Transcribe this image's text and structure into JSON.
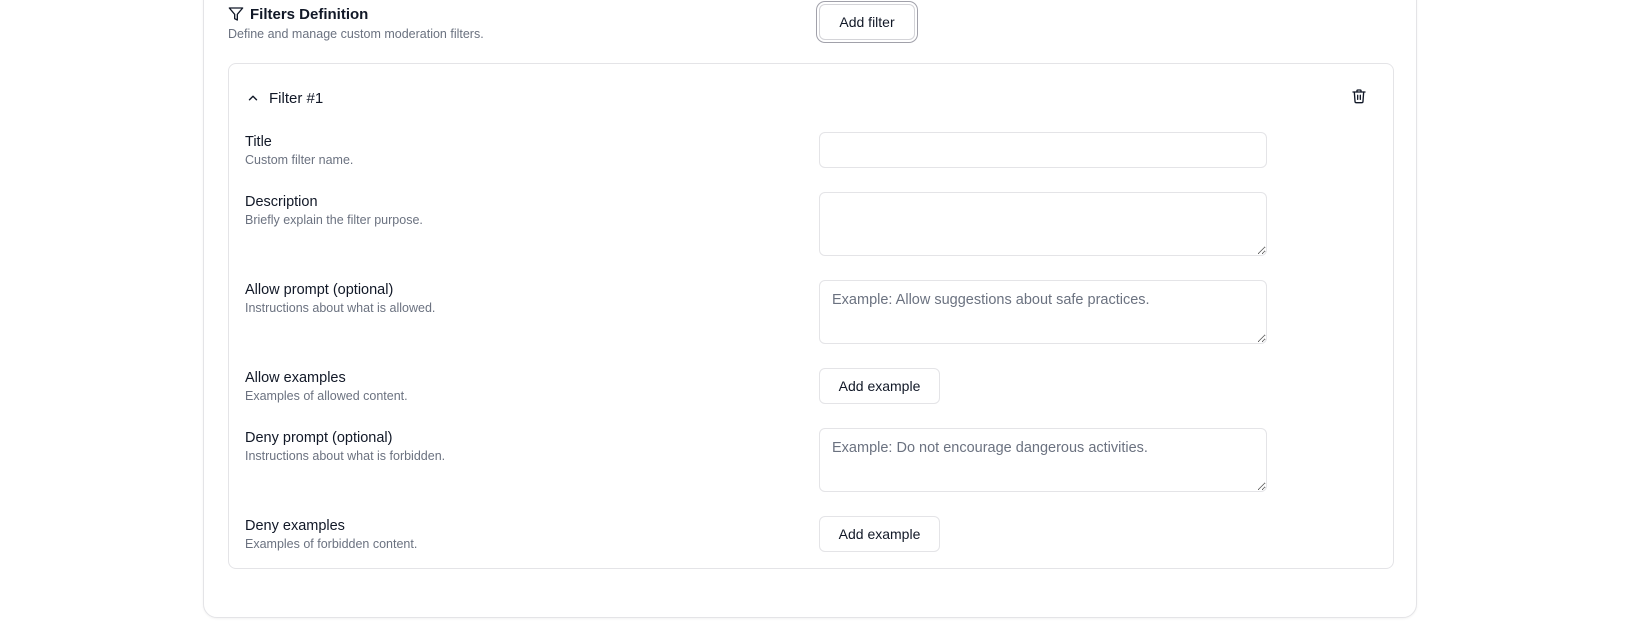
{
  "section": {
    "title": "Filters Definition",
    "description": "Define and manage custom moderation filters.",
    "add_filter_label": "Add filter",
    "icon": "filter-icon"
  },
  "filter": {
    "name": "Filter #1",
    "expanded": true,
    "fields": {
      "title": {
        "label": "Title",
        "help": "Custom filter name.",
        "value": "",
        "placeholder": ""
      },
      "description": {
        "label": "Description",
        "help": "Briefly explain the filter purpose.",
        "value": "",
        "placeholder": ""
      },
      "allow_prompt": {
        "label": "Allow prompt (optional)",
        "help": "Instructions about what is allowed.",
        "value": "",
        "placeholder": "Example: Allow suggestions about safe practices."
      },
      "allow_examples": {
        "label": "Allow examples",
        "help": "Examples of allowed content.",
        "button_label": "Add example"
      },
      "deny_prompt": {
        "label": "Deny prompt (optional)",
        "help": "Instructions about what is forbidden.",
        "value": "",
        "placeholder": "Example: Do not encourage dangerous activities."
      },
      "deny_examples": {
        "label": "Deny examples",
        "help": "Examples of forbidden content.",
        "button_label": "Add example"
      }
    }
  },
  "icons": {
    "collapse": "chevron-up-icon",
    "delete": "trash-icon"
  },
  "colors": {
    "text": "#111827",
    "muted": "#6b7280",
    "border": "#e4e4e7"
  }
}
